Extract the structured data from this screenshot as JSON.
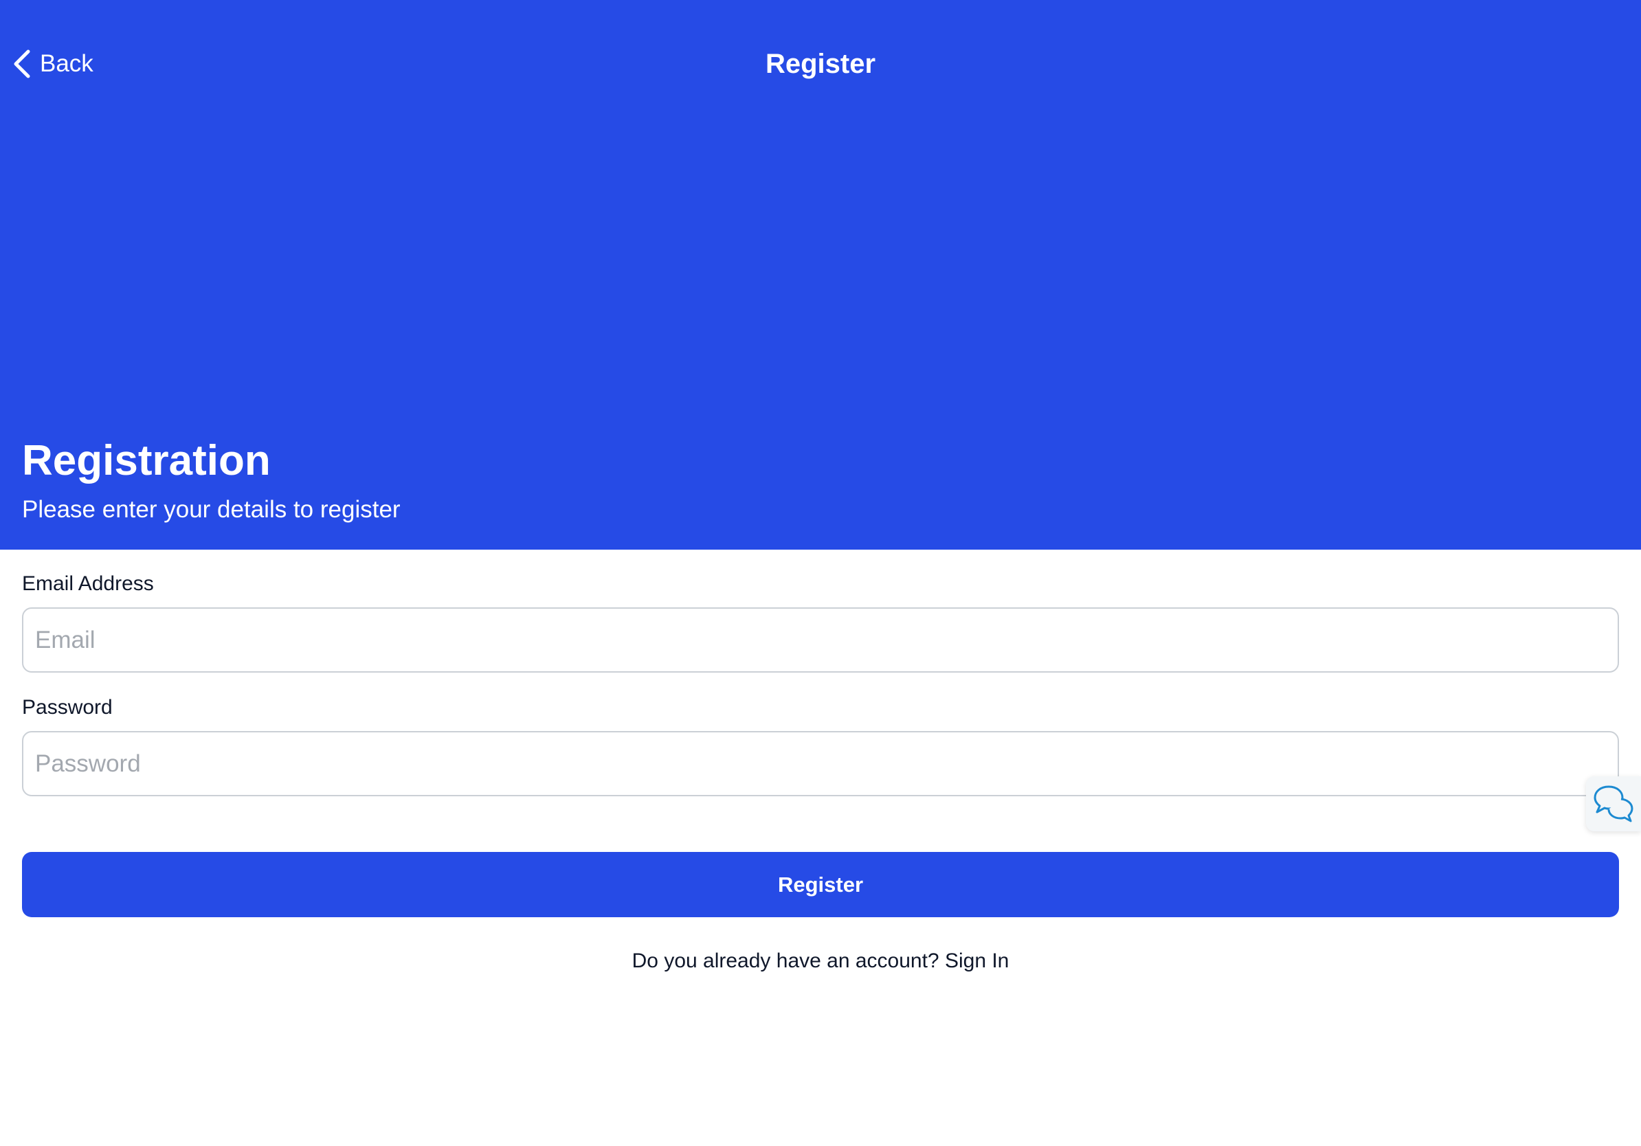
{
  "colors": {
    "brand": "#264be6",
    "chat_icon": "#1c8ad1"
  },
  "nav": {
    "back_label": "Back",
    "title": "Register",
    "back_icon": "chevron-left-icon"
  },
  "hero": {
    "title": "Registration",
    "subtitle": "Please enter your details to register"
  },
  "form": {
    "email": {
      "label": "Email Address",
      "placeholder": "Email",
      "value": ""
    },
    "password": {
      "label": "Password",
      "placeholder": "Password",
      "value": ""
    },
    "submit_label": "Register"
  },
  "footer": {
    "prompt": "Do you already have an account?",
    "link_label": "Sign In"
  },
  "chat_widget": {
    "icon": "chat-bubbles-icon"
  }
}
